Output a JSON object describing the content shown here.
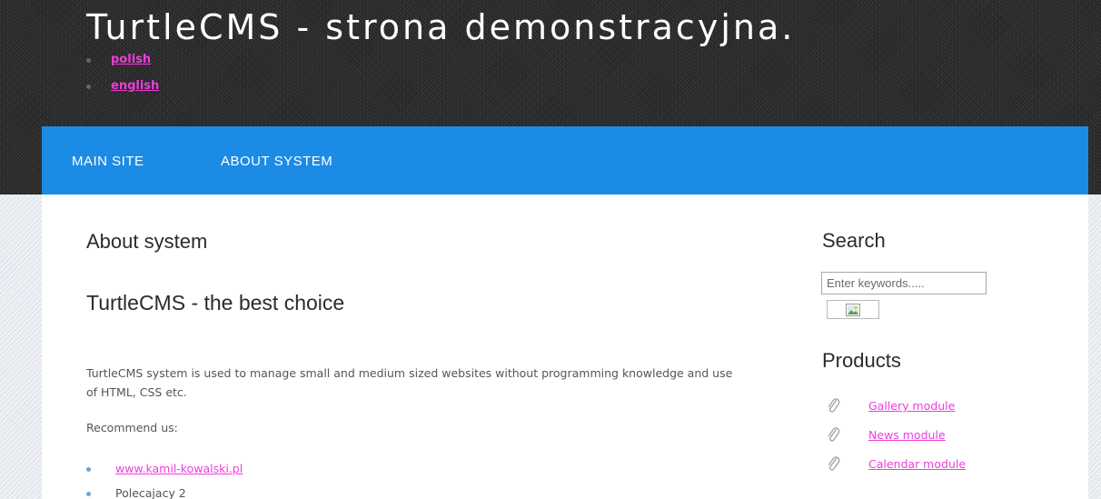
{
  "header": {
    "site_title": "TurtleCMS - strona demonstracyjna.",
    "languages": [
      {
        "label": "polish"
      },
      {
        "label": "english"
      }
    ]
  },
  "nav": {
    "items": [
      {
        "label": "MAIN SITE"
      },
      {
        "label": "ABOUT SYSTEM"
      }
    ]
  },
  "main": {
    "page_heading": "About system",
    "article_title": "TurtleCMS - the best choice",
    "body_text": "TurtleCMS system is used to manage small and medium sized websites without programming knowledge and use of HTML, CSS etc.",
    "recommend_label": "Recommend us:",
    "recommend_items": [
      {
        "label": "www.kamil-kowalski.pl",
        "is_link": true
      },
      {
        "label": "Polecajacy 2",
        "is_link": false
      }
    ]
  },
  "sidebar": {
    "search": {
      "heading": "Search",
      "placeholder": "Enter keywords....."
    },
    "products": {
      "heading": "Products",
      "items": [
        {
          "label": "Gallery module",
          "icon": "paperclip-icon"
        },
        {
          "label": "News module",
          "icon": "paperclip-icon"
        },
        {
          "label": "Calendar module",
          "icon": "paperclip-icon"
        }
      ]
    }
  },
  "colors": {
    "nav_bar": "#1c8be6",
    "link": "#ee3ddd",
    "header_bg": "#2f2f2f"
  }
}
